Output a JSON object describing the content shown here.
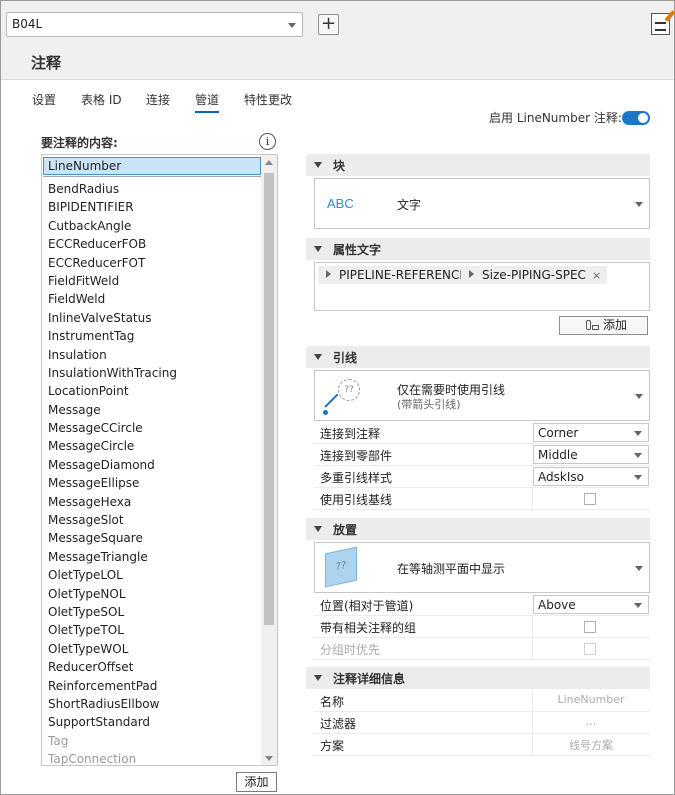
{
  "header": {
    "selector_value": "B04L",
    "add_button_label": "+",
    "title": "注释"
  },
  "tabs": [
    {
      "label": "设置",
      "active": false
    },
    {
      "label": "表格 ID",
      "active": false
    },
    {
      "label": "连接",
      "active": false
    },
    {
      "label": "管道",
      "active": true
    },
    {
      "label": "特性更改",
      "active": false
    }
  ],
  "enable_toggle": {
    "label": "启用 LineNumber 注释:",
    "on": true
  },
  "left_panel": {
    "label": "要注释的内容:",
    "selected_item": "LineNumber",
    "items": [
      "BendRadius",
      "BIPIDENTIFIER",
      "CutbackAngle",
      "ECCReducerFOB",
      "ECCReducerFOT",
      "FieldFitWeld",
      "FieldWeld",
      "InlineValveStatus",
      "InstrumentTag",
      "Insulation",
      "InsulationWithTracing",
      "LocationPoint",
      "Message",
      "MessageCCircle",
      "MessageCircle",
      "MessageDiamond",
      "MessageEllipse",
      "MessageHexa",
      "MessageSlot",
      "MessageSquare",
      "MessageTriangle",
      "OletTypeLOL",
      "OletTypeNOL",
      "OletTypeSOL",
      "OletTypeTOL",
      "OletTypeWOL",
      "ReducerOffset",
      "ReinforcementPad",
      "ShortRadiusEllbow",
      "SupportStandard"
    ],
    "dim_items": [
      "Tag",
      "TapConnection"
    ],
    "add_button": "添加"
  },
  "block_section": {
    "title": "块",
    "abc": "ABC",
    "value": "文字"
  },
  "attr_section": {
    "title": "属性文字",
    "chips": [
      {
        "label": "PIPELINE-REFERENCE-"
      },
      {
        "label": "Size-PIPING-SPEC"
      }
    ],
    "chip_close": "×",
    "add_button": "添加"
  },
  "leader_section": {
    "title": "引线",
    "icon_text": "??",
    "option_title": "仅在需要时使用引线",
    "option_sub": "(带箭头引线)",
    "props": [
      {
        "key": "连接到注释",
        "value": "Corner"
      },
      {
        "key": "连接到零部件",
        "value": "Middle"
      },
      {
        "key": "多重引线样式",
        "value": "AdskIso"
      }
    ],
    "use_leader_baseline": "使用引线基线"
  },
  "placement_section": {
    "title": "放置",
    "icon_text": "??",
    "option_title": "在等轴测平面中显示",
    "position_key": "位置(相对于管道)",
    "position_value": "Above",
    "group_key": "带有相关注释的组",
    "priority_key": "分组时优先"
  },
  "details_section": {
    "title": "注释详细信息",
    "rows": [
      {
        "key": "名称",
        "value": "LineNumber"
      },
      {
        "key": "过滤器",
        "value": "..."
      },
      {
        "key": "方案",
        "value": "线号方案"
      }
    ]
  },
  "colors": {
    "accent": "#1a78c7",
    "selection": "#cce4f7",
    "section_bg": "#ececec"
  }
}
